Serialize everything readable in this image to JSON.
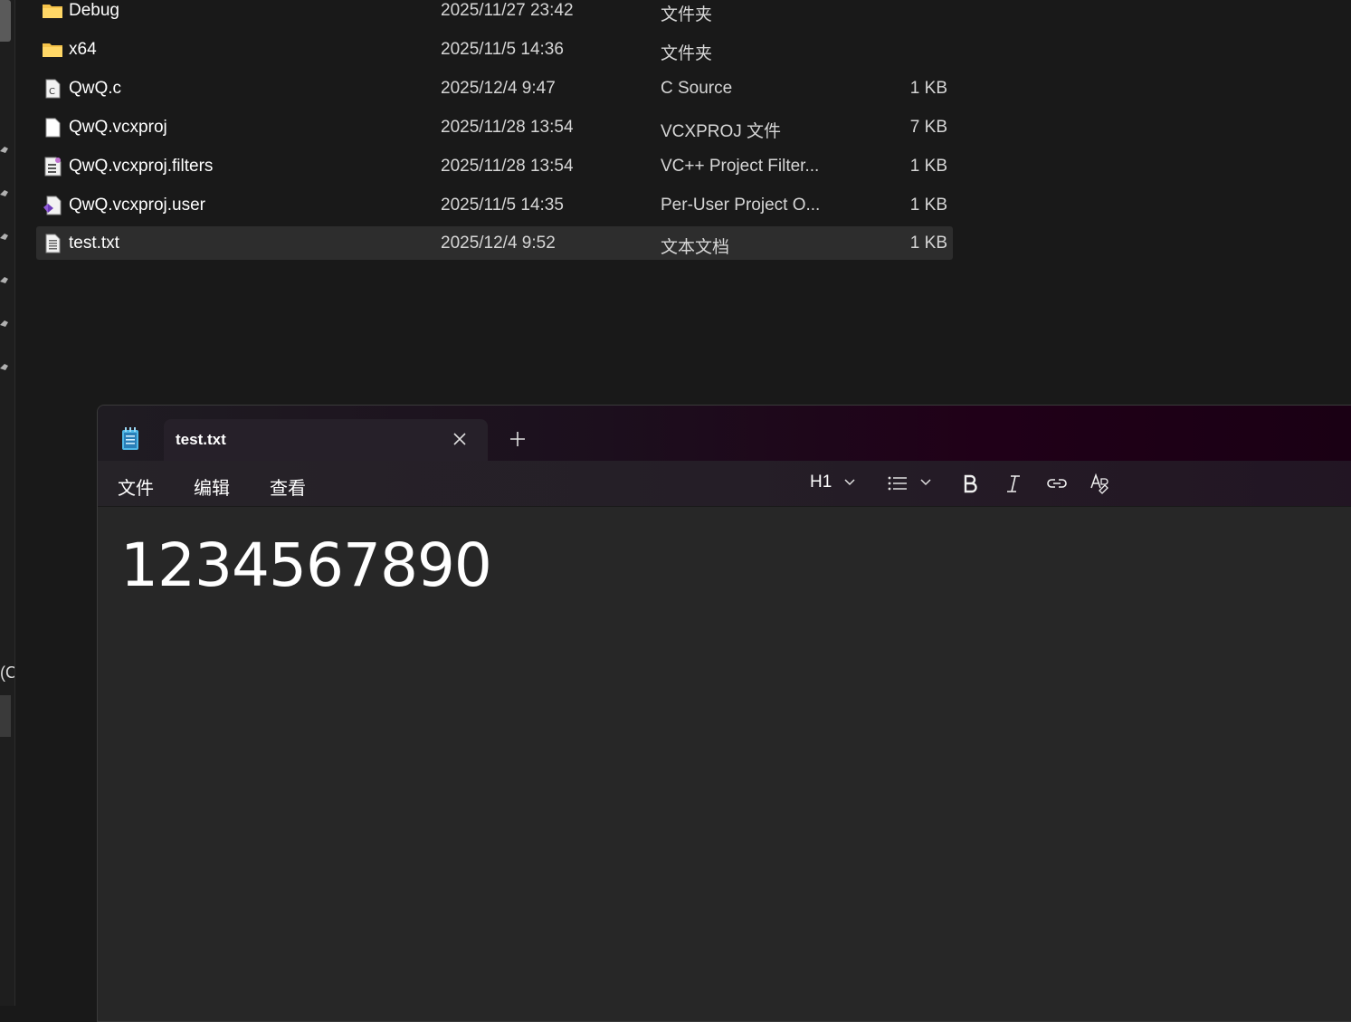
{
  "explorer": {
    "files": [
      {
        "name": "Debug",
        "date": "2025/11/27 23:42",
        "type": "文件夹",
        "size": "",
        "icon": "folder-icon"
      },
      {
        "name": "x64",
        "date": "2025/11/5 14:36",
        "type": "文件夹",
        "size": "",
        "icon": "folder-icon"
      },
      {
        "name": "QwQ.c",
        "date": "2025/12/4 9:47",
        "type": "C Source",
        "size": "1 KB",
        "icon": "c-source-file-icon"
      },
      {
        "name": "QwQ.vcxproj",
        "date": "2025/11/28 13:54",
        "type": "VCXPROJ 文件",
        "size": "7 KB",
        "icon": "blank-file-icon"
      },
      {
        "name": "QwQ.vcxproj.filters",
        "date": "2025/11/28 13:54",
        "type": "VC++ Project Filter...",
        "size": "1 KB",
        "icon": "filters-file-icon"
      },
      {
        "name": "QwQ.vcxproj.user",
        "date": "2025/11/5 14:35",
        "type": "Per-User Project O...",
        "size": "1 KB",
        "icon": "vs-user-file-icon"
      },
      {
        "name": "test.txt",
        "date": "2025/12/4 9:52",
        "type": "文本文档",
        "size": "1 KB",
        "icon": "text-file-icon",
        "selected": true
      }
    ],
    "sidebar_clipped_text": "(C"
  },
  "notepad": {
    "app_icon": "notepad-icon",
    "tab_title": "test.txt",
    "menu": {
      "file": "文件",
      "edit": "编辑",
      "view": "查看"
    },
    "toolbar": {
      "heading": "H1"
    },
    "content": "1234567890",
    "colors": {
      "accent_titlebar": "#200018",
      "editor_bg": "#272727"
    }
  }
}
